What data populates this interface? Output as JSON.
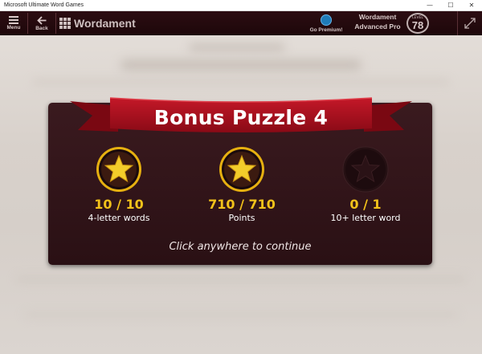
{
  "window": {
    "title": "Microsoft Ultimate Word Games",
    "controls": {
      "minimize": "—",
      "maximize": "☐",
      "close": "✕"
    }
  },
  "appbar": {
    "menu_label": "Menu",
    "back_label": "Back",
    "brand_name": "Wordament",
    "premium_label": "Go Premium!",
    "advanced_line1": "Wordament",
    "advanced_line2": "Advanced Pro",
    "level_label": "LEVEL",
    "level_value": "78"
  },
  "results": {
    "title": "Bonus Puzzle 4",
    "stats": [
      {
        "value": "10 / 10",
        "caption": "4-letter words",
        "achieved": true
      },
      {
        "value": "710 / 710",
        "caption": "Points",
        "achieved": true
      },
      {
        "value": "0 / 1",
        "caption": "10+ letter word",
        "achieved": false
      }
    ],
    "continue_text": "Click anywhere to continue"
  },
  "colors": {
    "appbar": "#24090d",
    "card": "#31151a",
    "ribbon": "#a8101f",
    "gold": "#f2c21a"
  }
}
